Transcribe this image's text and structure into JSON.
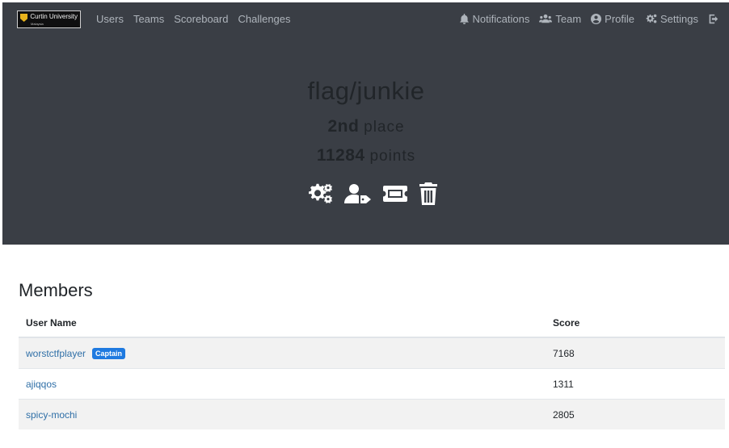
{
  "nav": {
    "logo_text": "Curtin University",
    "logo_sub": "Malaysia",
    "links": [
      "Users",
      "Teams",
      "Scoreboard",
      "Challenges"
    ],
    "right": {
      "notifications": "Notifications",
      "team": "Team",
      "profile": "Profile",
      "settings": "Settings"
    }
  },
  "hero": {
    "team_name": "flag/junkie",
    "place_value": "2nd",
    "place_label": "place",
    "points_value": "11284",
    "points_label": "points"
  },
  "actions": [
    "settings-icon",
    "transfer-ownership-icon",
    "invite-ticket-icon",
    "trash-icon"
  ],
  "members": {
    "title": "Members",
    "columns": [
      "User Name",
      "Score"
    ],
    "rows": [
      {
        "name": "worstctfplayer",
        "badge": "Captain",
        "score": "7168"
      },
      {
        "name": "ajiqqos",
        "badge": "",
        "score": "1311"
      },
      {
        "name": "spicy-mochi",
        "badge": "",
        "score": "2805"
      }
    ]
  }
}
